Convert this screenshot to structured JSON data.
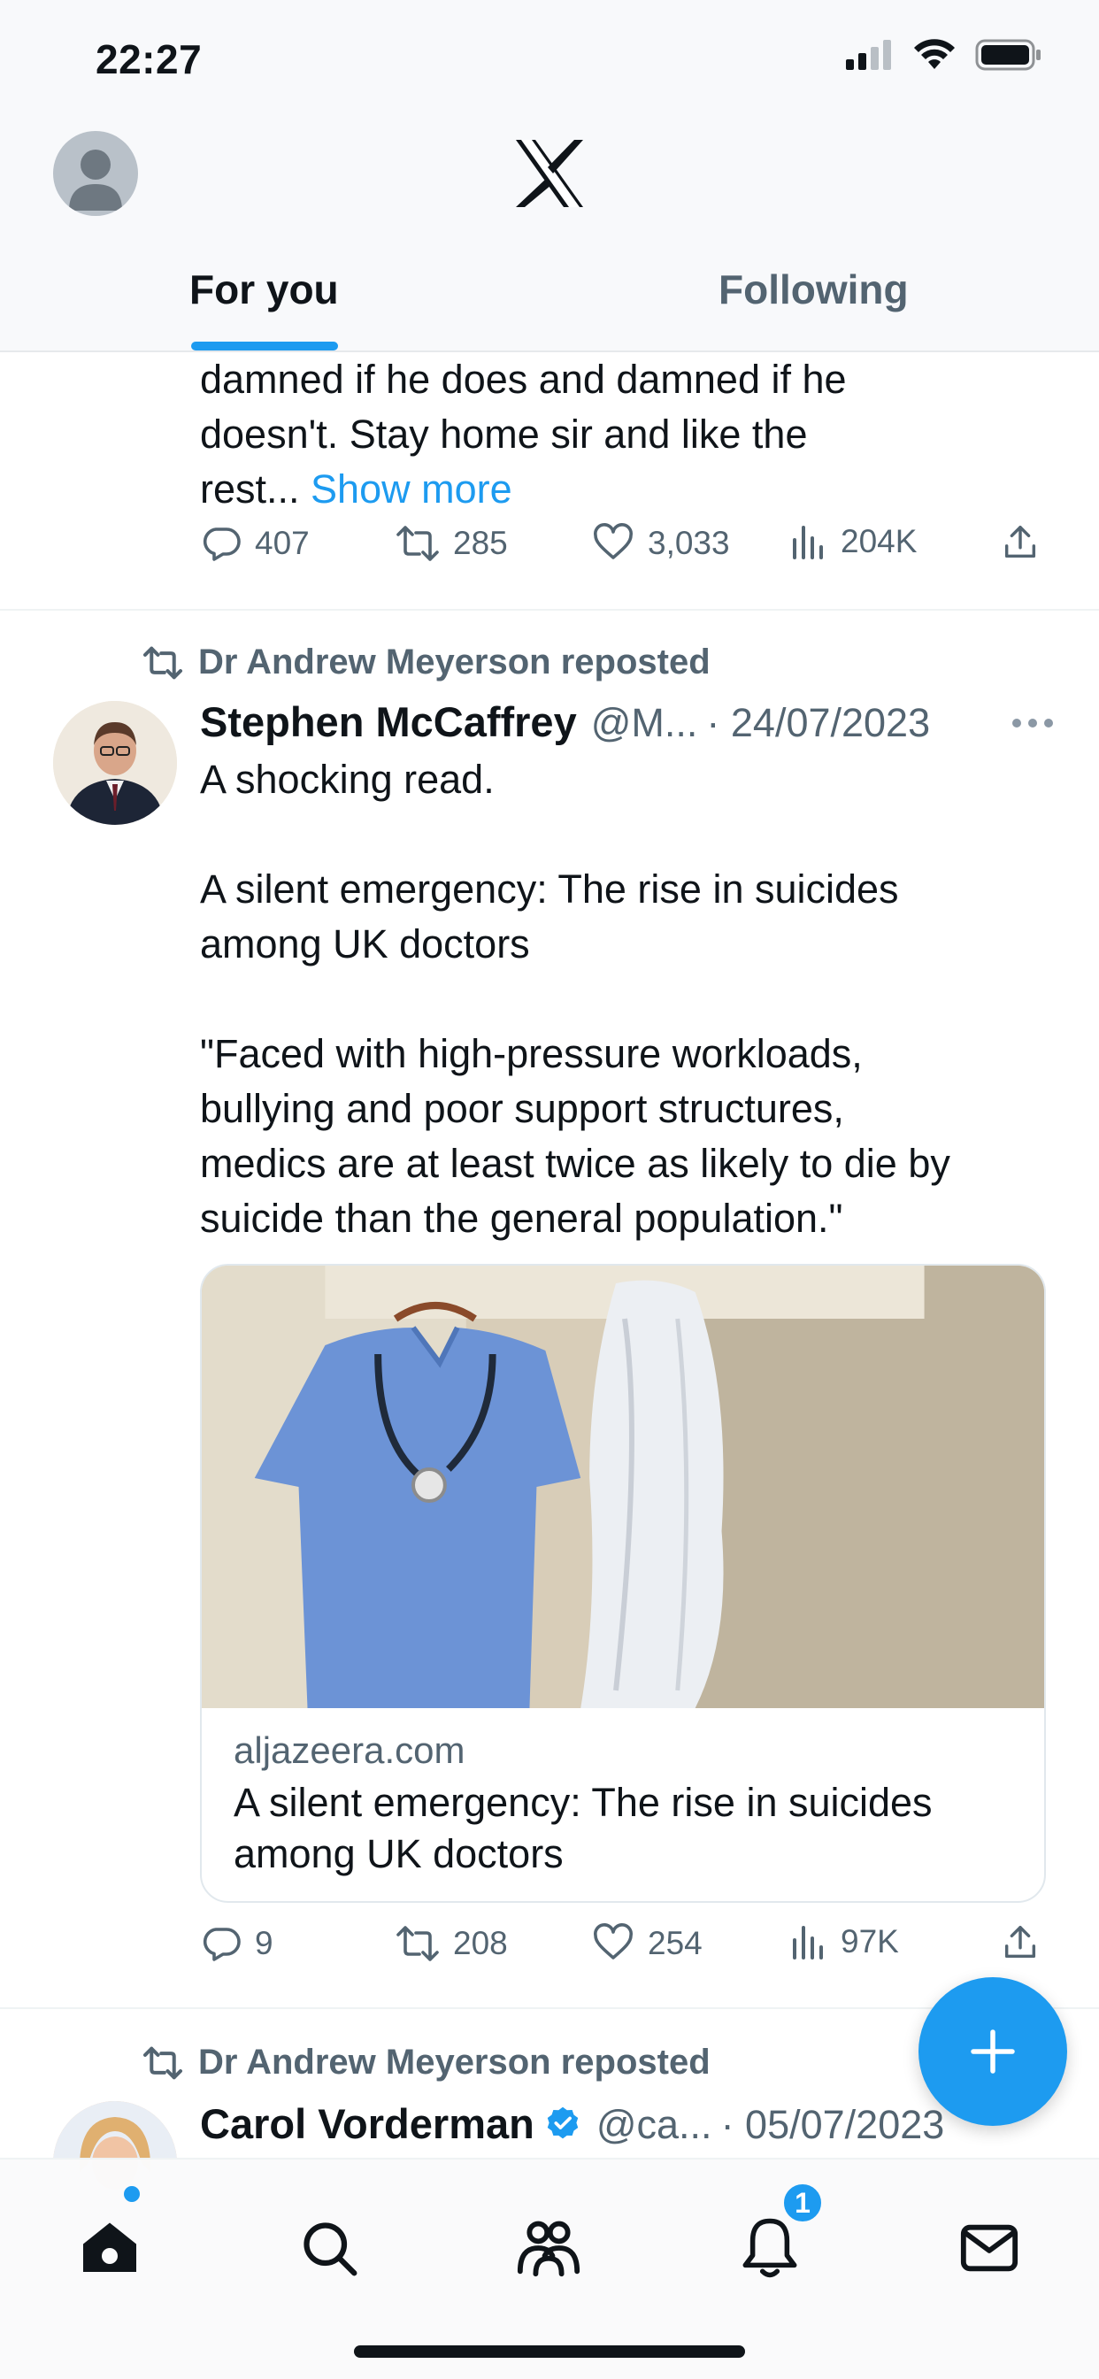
{
  "status_bar": {
    "time": "22:27"
  },
  "header": {
    "tabs": [
      {
        "label": "For you",
        "selected": true
      },
      {
        "label": "Following",
        "selected": false
      }
    ]
  },
  "colors": {
    "accent": "#1d9bf0",
    "text": "#0f1419",
    "secondary": "#536471"
  },
  "posts": [
    {
      "text_lines": [
        "damned if he does and damned if he",
        "doesn't. Stay home sir and like the",
        "rest..."
      ],
      "show_more": "Show more",
      "actions": {
        "replies": "407",
        "reposts": "285",
        "likes": "3,033",
        "views": "204K"
      }
    },
    {
      "repost_label": "Dr Andrew Meyerson reposted",
      "author": "Stephen McCaffrey",
      "handle": "@M...",
      "date": "· 24/07/2023",
      "text": "A shocking read.\n\nA silent emergency: The rise in suicides\namong UK doctors\n\n\"Faced with high-pressure workloads,\nbullying and poor support structures,\nmedics are at least twice as likely to die by\nsuicide than the general population.\"",
      "card": {
        "domain": "aljazeera.com",
        "title": "A silent emergency: The rise in suicides among UK doctors"
      },
      "actions": {
        "replies": "9",
        "reposts": "208",
        "likes": "254",
        "views": "97K"
      }
    },
    {
      "repost_label": "Dr Andrew Meyerson reposted",
      "author": "Carol Vorderman",
      "verified": true,
      "handle": "@ca...",
      "date": "· 05/07/2023"
    }
  ],
  "bottom_nav": {
    "items": [
      "home-icon",
      "search-icon",
      "communities-icon",
      "notifications-icon",
      "messages-icon"
    ],
    "notifications_badge": "1"
  }
}
